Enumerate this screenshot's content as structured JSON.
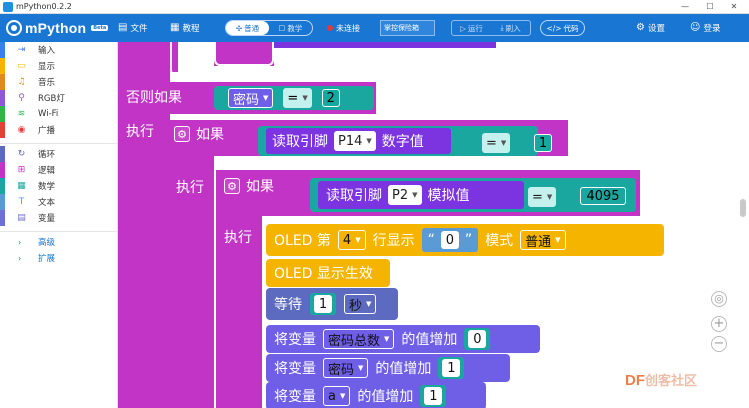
{
  "window": {
    "title": "mPython0.2.2",
    "controls": [
      "—",
      "☐",
      "✕"
    ]
  },
  "header": {
    "logo_text": "mPython",
    "logo_badge": "Beta",
    "files_label": "文件",
    "tutorial_label": "教程",
    "mode_normal": "普通",
    "mode_teach": "教学",
    "connection_status": "未连接",
    "device_select": "掌控保险箱",
    "run_label": "运行",
    "flash_label": "刷入",
    "code_label": "代码",
    "settings_label": "设置",
    "login_label": "登录",
    "colors": {
      "header_bg": "#1976d2",
      "status_dot": "#e53935"
    }
  },
  "sidebar": {
    "categories": [
      {
        "label": "输入",
        "color": "#3b7ef0",
        "icon": "input-icon"
      },
      {
        "label": "显示",
        "color": "#f5b400",
        "icon": "display-icon"
      },
      {
        "label": "音乐",
        "color": "#e08a1e",
        "icon": "music-icon"
      },
      {
        "label": "RGB灯",
        "color": "#8e58d6",
        "icon": "bulb-icon"
      },
      {
        "label": "Wi-Fi",
        "color": "#2fb34a",
        "icon": "wifi-icon"
      },
      {
        "label": "广播",
        "color": "#e0413b",
        "icon": "broadcast-icon"
      },
      {
        "label": "循环",
        "color": "#5c6bc0",
        "icon": "loop-icon"
      },
      {
        "label": "逻辑",
        "color": "#c234c6",
        "icon": "logic-icon"
      },
      {
        "label": "数学",
        "color": "#1aa7a0",
        "icon": "math-icon"
      },
      {
        "label": "文本",
        "color": "#5a9bd5",
        "icon": "text-icon"
      },
      {
        "label": "变量",
        "color": "#6f6fd8",
        "icon": "variable-icon"
      }
    ],
    "advanced_label": "高级",
    "extend_label": "扩展"
  },
  "blocks": {
    "else_if_label": "否则如果",
    "exec_label": "执行",
    "if_label": "如果",
    "var_password": "密码",
    "eq_op": "=",
    "num_2": "2",
    "read_pin_label": "读取引脚",
    "pin_p14": "P14",
    "digital_value": "数字值",
    "num_1": "1",
    "pin_p2": "P2",
    "analog_value": "模拟值",
    "num_4095": "4095",
    "oled_prefix": "OLED 第",
    "oled_row": "4",
    "oled_row_show": "行显示",
    "quote_open": "“",
    "oled_text": "0",
    "quote_close": "”",
    "mode_label": "模式",
    "mode_value": "普通",
    "oled_apply": "OLED 显示生效",
    "wait_label": "等待",
    "wait_value": "1",
    "wait_unit": "秒",
    "set_var_label": "将变量",
    "var_total": "密码总数",
    "increase_label": "的值增加",
    "inc_val_0": "0",
    "var_pw2": "密码",
    "inc_val_1": "1",
    "var_a": "a",
    "inc_val_a": "1"
  },
  "colors": {
    "logic": "#c234c6",
    "io_purple": "#7c33e0",
    "math": "#1aa7a0",
    "variable": "#6e5fe6",
    "oled": "#f5b400",
    "loop": "#5c6bc0"
  },
  "watermark": {
    "brand": "DF",
    "suffix": "创客社区"
  }
}
